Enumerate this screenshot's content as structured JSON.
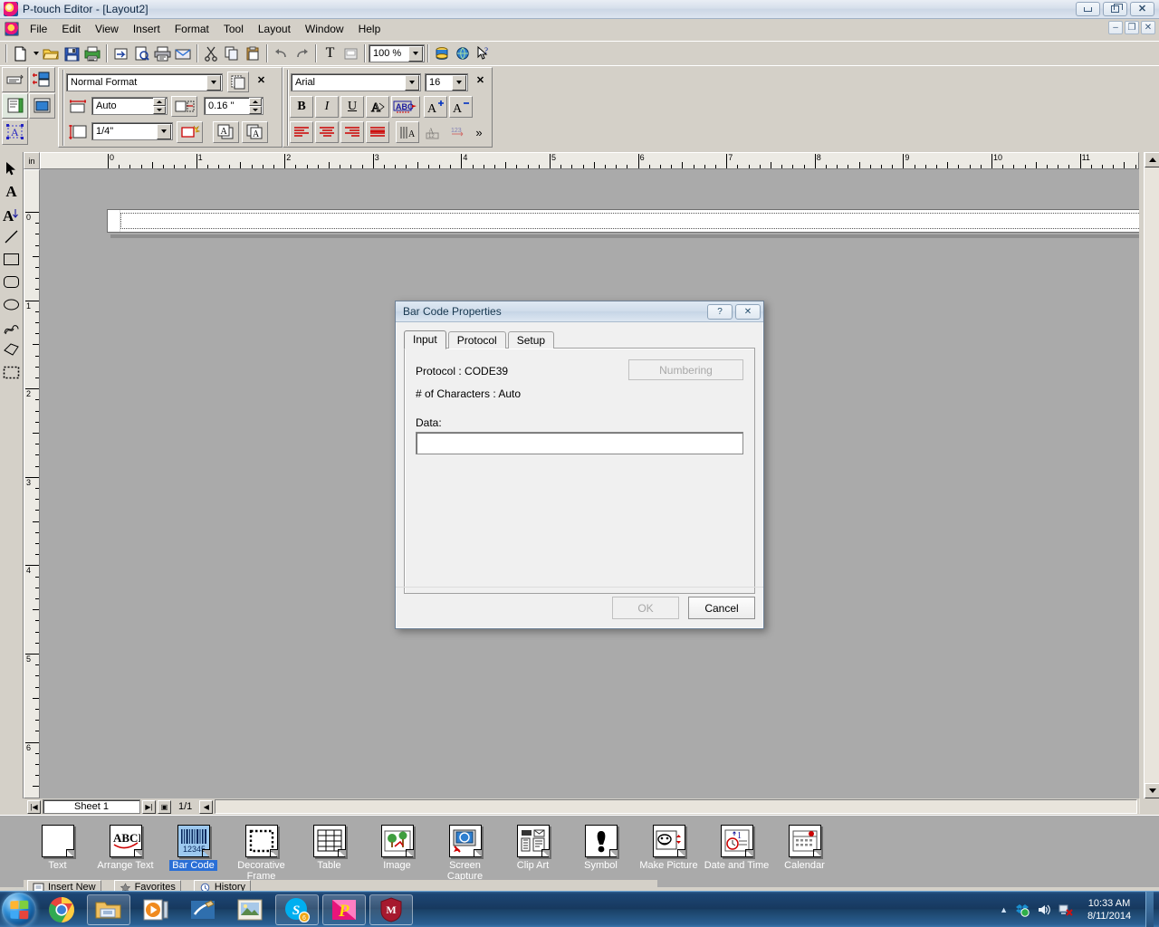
{
  "window": {
    "title": "P-touch Editor - [Layout2]",
    "icon": "ptouch-logo-icon",
    "controls": {
      "minimize": "–",
      "maximize": "❐",
      "close": "✕"
    },
    "mdi_controls": {
      "minimize": "–",
      "restore": "❐",
      "close": "✕"
    }
  },
  "menubar": {
    "items": [
      "File",
      "Edit",
      "View",
      "Insert",
      "Format",
      "Tool",
      "Layout",
      "Window",
      "Help"
    ]
  },
  "standard_toolbar": {
    "zoom_value": "100 %",
    "buttons": [
      "new-document-icon",
      "new-document-dropdown-icon",
      "open-icon",
      "save-icon",
      "print-label-icon",
      "transfer-icon",
      "print-preview-icon",
      "print-icon",
      "mail-icon",
      "cut-icon",
      "copy-icon",
      "paste-icon",
      "undo-icon",
      "redo-icon",
      "text-icon",
      "frame-icon",
      "database-icon",
      "globe-icon",
      "help-pointer-icon"
    ]
  },
  "property_toolbar": {
    "layout_style": "Normal Format",
    "layout_style_aria": "layout-style-combo",
    "length_mode": "Auto",
    "margin_value": "0.16 \"",
    "tape_width": "1/4\"",
    "close_label": "✕"
  },
  "font_toolbar": {
    "font_name": "Arial",
    "font_size": "16",
    "close_label": "✕",
    "bold": "B",
    "italic": "I",
    "underline": "U",
    "outline": "A",
    "text_effect": "ABC",
    "increase_size": "A",
    "decrease_size": "A",
    "overflow": "»"
  },
  "tool_palette": {
    "items": [
      "select-arrow-tool",
      "text-tool",
      "arrange-text-tool",
      "line-tool",
      "rectangle-tool",
      "rounded-rectangle-tool",
      "ellipse-tool",
      "curve-tool",
      "polygon-tool",
      "clip-area-tool"
    ]
  },
  "rulers": {
    "unit": "in",
    "horizontal_labels": [
      "0",
      "1",
      "2",
      "3",
      "4",
      "5",
      "6",
      "7",
      "8",
      "9",
      "10",
      "11"
    ],
    "vertical_labels": [
      "0",
      "1",
      "2",
      "3",
      "4",
      "5",
      "6"
    ]
  },
  "sheet_bar": {
    "first_label": "|◀",
    "sheet_name": "Sheet 1",
    "last_label": "▶|",
    "new_sheet_label": "▣",
    "page_indicator": "1/1",
    "scroll_left": "◀"
  },
  "bottom_palette": {
    "items": [
      {
        "label": "Text",
        "icon": "text-a-icon",
        "selected": false
      },
      {
        "label": "Arrange Text",
        "icon": "arrange-text-abcd-icon",
        "selected": false
      },
      {
        "label": "Bar Code",
        "icon": "barcode-icon",
        "selected": true
      },
      {
        "label": "Decorative Frame",
        "icon": "decorative-frame-icon",
        "selected": false
      },
      {
        "label": "Table",
        "icon": "table-grid-icon",
        "selected": false
      },
      {
        "label": "Image",
        "icon": "image-tree-icon",
        "selected": false
      },
      {
        "label": "Screen Capture",
        "icon": "screen-capture-icon",
        "selected": false
      },
      {
        "label": "Clip Art",
        "icon": "clip-art-icon",
        "selected": false
      },
      {
        "label": "Symbol",
        "icon": "symbol-exclamation-icon",
        "selected": false
      },
      {
        "label": "Make Picture",
        "icon": "make-picture-icon",
        "selected": false
      },
      {
        "label": "Date and Time",
        "icon": "date-time-clock-icon",
        "selected": false
      },
      {
        "label": "Calendar",
        "icon": "calendar-icon",
        "selected": false
      }
    ]
  },
  "mini_tabs": [
    {
      "label": "Insert New",
      "icon": "insert-new-icon"
    },
    {
      "label": "Favorites",
      "icon": "favorites-icon"
    },
    {
      "label": "History",
      "icon": "history-icon"
    }
  ],
  "dialog": {
    "title": "Bar Code Properties",
    "help_button": "?",
    "close_button": "✕",
    "tabs": [
      {
        "label": "Input",
        "active": true
      },
      {
        "label": "Protocol",
        "active": false
      },
      {
        "label": "Setup",
        "active": false
      }
    ],
    "protocol_line": "Protocol : CODE39",
    "characters_line": "# of Characters : Auto",
    "numbering_button": "Numbering",
    "numbering_disabled": true,
    "data_label": "Data:",
    "data_value": "",
    "data_placeholder": "",
    "ok_button": "OK",
    "ok_disabled": true,
    "cancel_button": "Cancel"
  },
  "taskbar": {
    "start_label": "start-orb-icon",
    "items": [
      {
        "name": "chrome-taskbar-icon",
        "pinned": false
      },
      {
        "name": "explorer-taskbar-icon",
        "pinned": true
      },
      {
        "name": "media-player-taskbar-icon",
        "pinned": false
      },
      {
        "name": "paint-taskbar-icon",
        "pinned": false
      },
      {
        "name": "photo-viewer-taskbar-icon",
        "pinned": false
      },
      {
        "name": "skype-taskbar-icon",
        "pinned": true
      },
      {
        "name": "ptouch-taskbar-icon",
        "pinned": true
      },
      {
        "name": "mcafee-taskbar-icon",
        "pinned": true
      }
    ],
    "tray": {
      "overflow": "▲",
      "icons": [
        "dropbox-tray-icon",
        "volume-tray-icon",
        "network-tray-icon"
      ],
      "time": "10:33 AM",
      "date": "8/11/2014"
    }
  },
  "colors": {
    "canvas_bg": "#aaaaaa",
    "chrome_bg": "#d4d0c8",
    "dialog_bg": "#f0f0f0",
    "selection_blue": "#2a6fd6",
    "taskbar_blue": "#17395f"
  }
}
